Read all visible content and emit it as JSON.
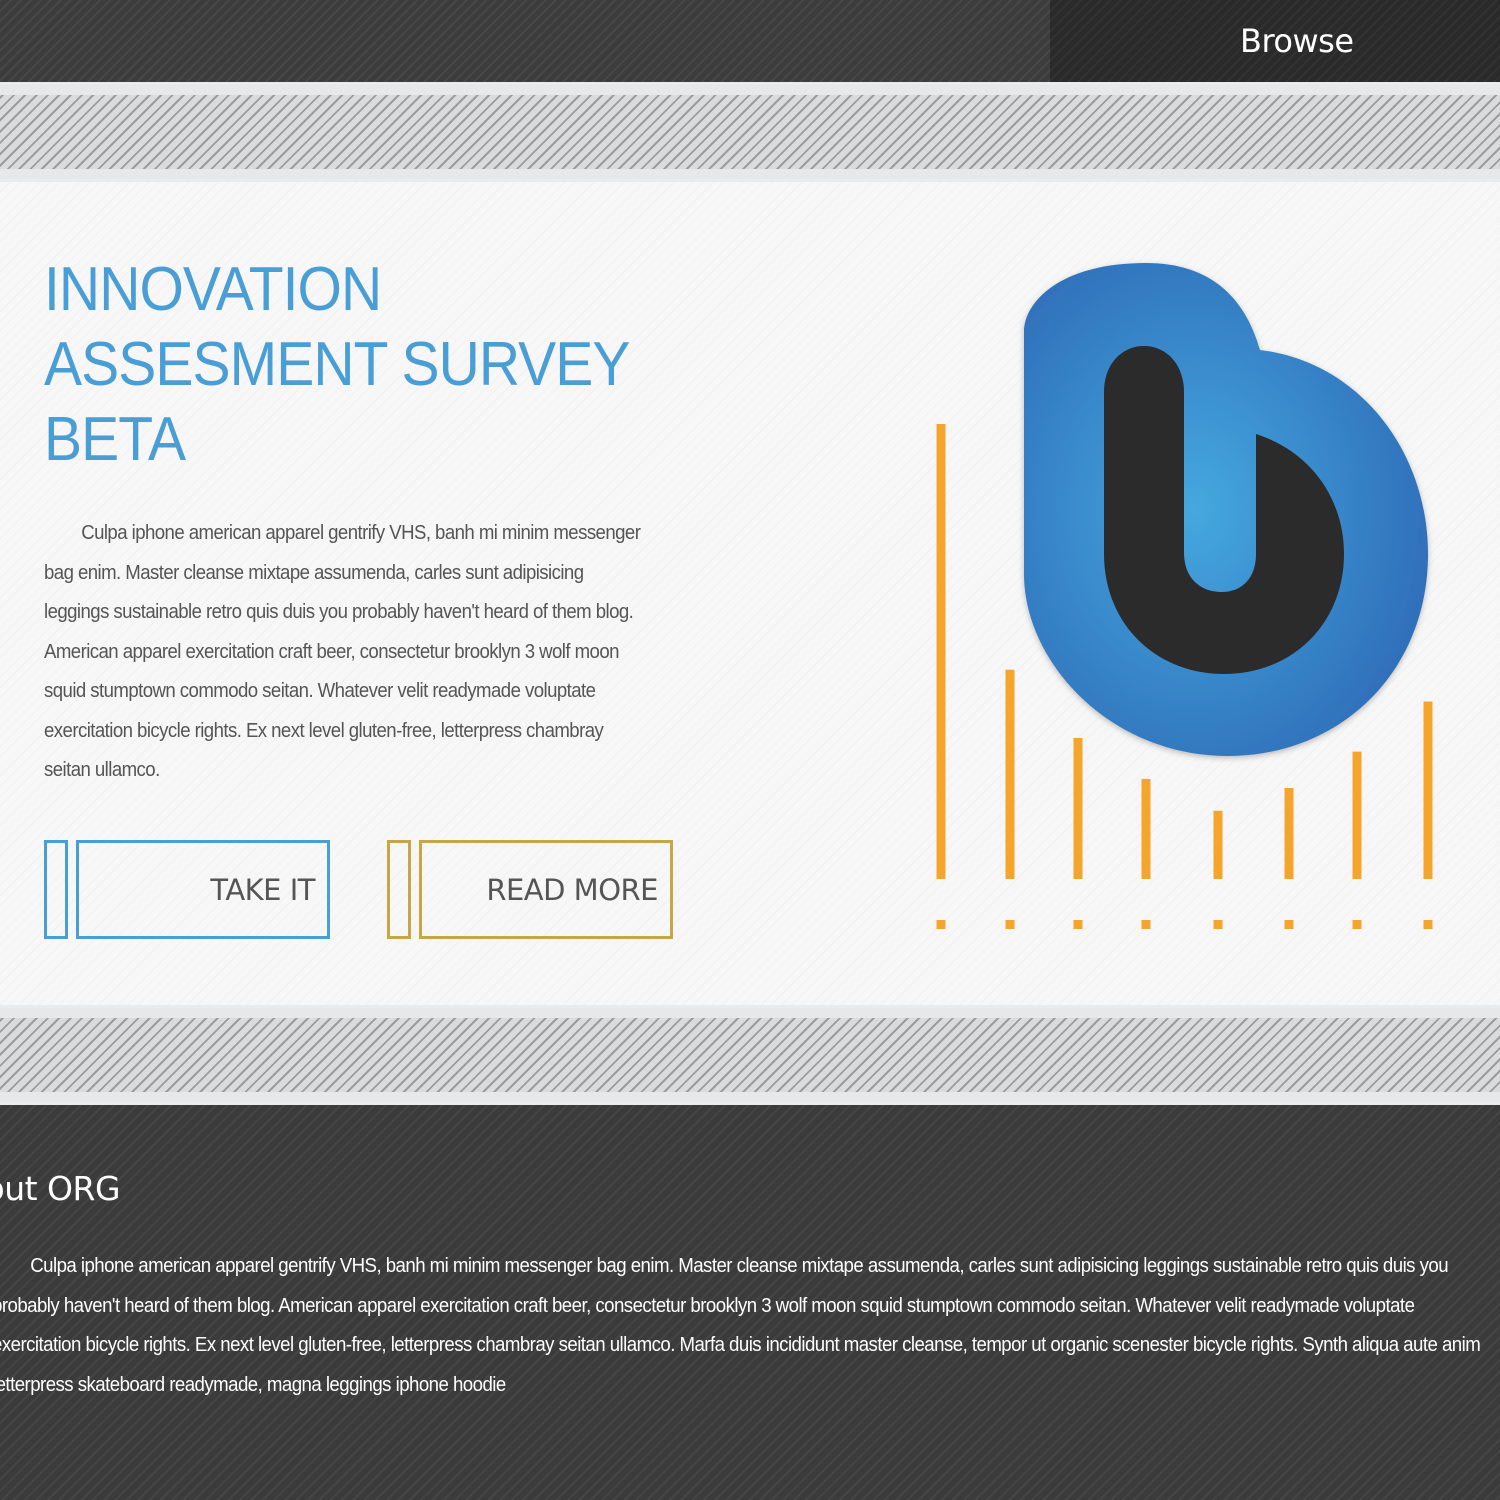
{
  "nav": {
    "browse_label": "Browse"
  },
  "hero": {
    "title_lines": [
      "INNOVATION",
      "ASSESMENT SURVEY",
      "BETA"
    ],
    "body": "Culpa iphone american apparel gentrify VHS, banh mi minim messenger bag enim. Master cleanse mixtape assumenda, carles sunt adipisicing leggings sustainable retro quis duis you probably haven't heard of them blog. American apparel exercitation craft beer, consectetur brooklyn 3 wolf moon squid stumptown commodo seitan. Whatever velit readymade voluptate exercitation bicycle rights. Ex next level gluten-free, letterpress chambray seitan ullamco.",
    "take_it_label": "TAKE IT",
    "read_more_label": "READ MORE"
  },
  "illustration": {
    "bar_levels": [
      1.0,
      0.46,
      0.31,
      0.22,
      0.15,
      0.2,
      0.28,
      0.39
    ],
    "bar_color": "#f4a52e",
    "logo_outer_color": "#2f6fba",
    "logo_center_color": "#45a8df",
    "logo_inner_color": "#2b2b2b"
  },
  "about": {
    "title": "About ORG",
    "body": "Culpa iphone american apparel gentrify VHS, banh mi minim messenger bag enim. Master cleanse mixtape assumenda, carles sunt adipisicing leggings sustainable retro quis duis you probably haven't heard of them blog. American apparel exercitation craft beer, consectetur brooklyn 3 wolf moon squid stumptown commodo seitan. Whatever velit readymade voluptate exercitation bicycle rights. Ex next level gluten-free, letterpress chambray seitan ullamco. Marfa duis incididunt master cleanse, tempor ut organic scenester bicycle rights. Synth aliqua aute anim letterpress skateboard readymade, magna leggings iphone hoodie"
  },
  "colors": {
    "accent_blue": "#4a9ed6",
    "accent_gold": "#c9a54a",
    "dark_bg": "#3b3b3b"
  }
}
